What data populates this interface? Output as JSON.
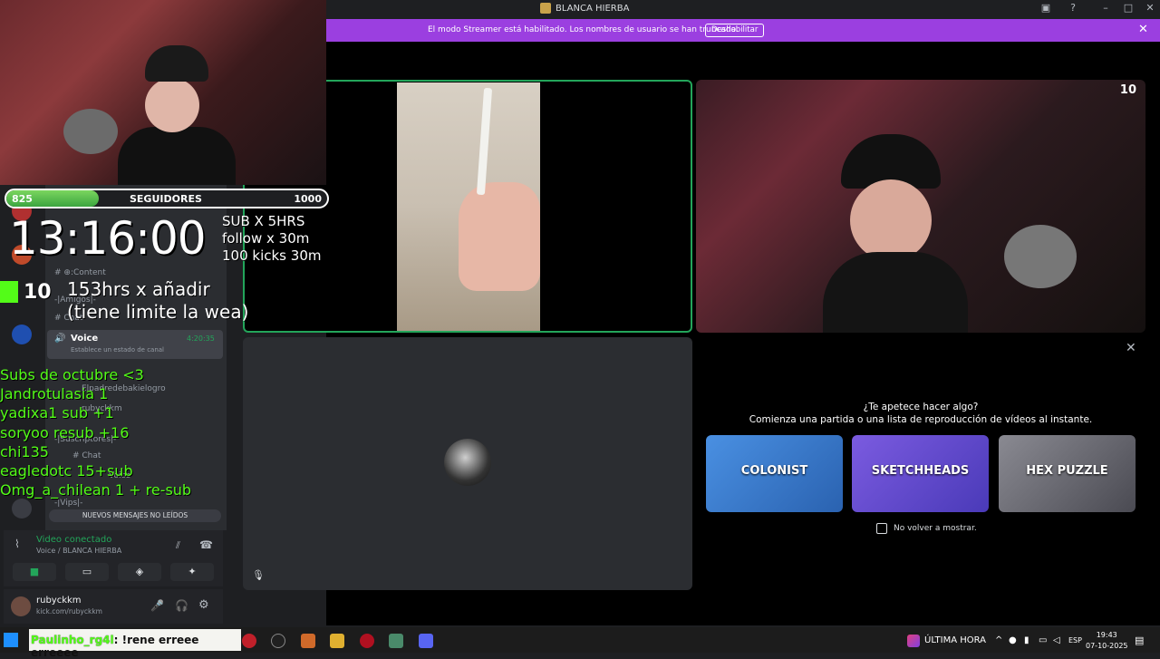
{
  "window": {
    "title": "BLANCA HIERBA"
  },
  "banner": {
    "text": "El modo Streamer está habilitado. Los nombres de usuario se han truncado.",
    "button": "Deshabilitar"
  },
  "tiles": {
    "remote_badge": "10"
  },
  "activity": {
    "heading": "¿Te apetece hacer algo?",
    "subheading": "Comienza una partida o una lista de reproducción de vídeos al instante.",
    "cards": [
      {
        "name": "COLONIST",
        "color": "#3b7fd6"
      },
      {
        "name": "SKETCHHEADS",
        "color": "#6b4ad6"
      },
      {
        "name": "HEX PUZZLE",
        "color": "#6a6a72"
      }
    ],
    "dont_show": "No volver a mostrar."
  },
  "sidebar": {
    "channels": [
      {
        "label": "# ⊕:Content"
      },
      {
        "label": "-|Amigos|-"
      },
      {
        "label": "# Chat"
      }
    ],
    "voice_channel": {
      "name": "Voice",
      "time": "4:20:35",
      "status": "Establece un estado de canal"
    },
    "members": [
      "Elpadredebakielogro",
      "rubyckkm"
    ],
    "more_channels": [
      "-|Suscriptores|-",
      "# Chat",
      "Voice",
      "-|Vips|-",
      "# Chat"
    ],
    "new_messages": "NUEVOS MENSAJES NO LEÍDOS"
  },
  "rtc": {
    "status": "Video conectado",
    "channel": "Voice / BLANCA HIERBA"
  },
  "user": {
    "name": "rubyckkm",
    "subtitle": "kick.com/rubyckkm"
  },
  "overlay": {
    "progress": {
      "current": "825",
      "label": "SEGUIDORES",
      "goal": "1000",
      "fraction": 0.825
    },
    "timer": "13:16:00",
    "rules": [
      "SUB X 5HRS",
      "follow x 30m",
      "100 kicks 30m"
    ],
    "note_line1": "153hrs  x añadir",
    "note_line2": "(tiene limite la wea)",
    "kicks": "10",
    "subs": [
      "Subs de octubre <3",
      "Jandrotulasia 1",
      "yadixa1 sub +1",
      "soryoo resub +16",
      "chi135",
      "eagledotc 15+sub",
      "Omg_a_chilean 1 + re-sub"
    ]
  },
  "taskbar": {
    "chat_user": "Paulinho_rg4l",
    "chat_msg": ": !rene erreee erreeee",
    "news": "ÚLTIMA HORA",
    "lang": "ESP",
    "time": "19:43",
    "date": "07-10-2025"
  }
}
